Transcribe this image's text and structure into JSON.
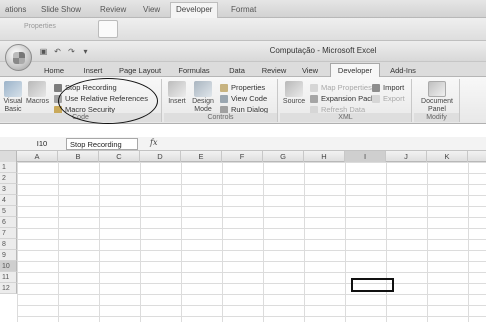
{
  "background_window": {
    "tabs": [
      "ations",
      "Slide Show",
      "Review",
      "View",
      "Developer",
      "Format"
    ],
    "active_tab": "Developer",
    "properties_label": "Properties"
  },
  "excel": {
    "title": "Computação - Microsoft Excel",
    "quick_access": [
      "save-icon",
      "undo-icon",
      "redo-icon",
      "dropdown-icon"
    ],
    "tabs": [
      "Home",
      "Insert",
      "Page Layout",
      "Formulas",
      "Data",
      "Review",
      "View",
      "Developer",
      "Add-Ins"
    ],
    "active_tab": "Developer",
    "ribbon": {
      "code": {
        "visual_basic": "Visual Basic",
        "macros": "Macros",
        "stop_recording": "Stop Recording",
        "relative_refs": "Use Relative References",
        "macro_security": "Macro Security",
        "label": "Code"
      },
      "controls": {
        "insert": "Insert",
        "design_mode": "Design Mode",
        "properties": "Properties",
        "view_code": "View Code",
        "run_dialog": "Run Dialog",
        "label": "Controls"
      },
      "xml": {
        "source": "Source",
        "map_properties": "Map Properties",
        "expansion_packs": "Expansion Packs",
        "refresh_data": "Refresh Data",
        "import": "Import",
        "export": "Export",
        "label": "XML"
      },
      "modify": {
        "document_panel": "Document Panel",
        "label": "Modify"
      }
    },
    "formula_bar": {
      "name_box": "I10",
      "content": "Stop Recording",
      "fx": "fx"
    },
    "columns": [
      "A",
      "B",
      "C",
      "D",
      "E",
      "F",
      "G",
      "H",
      "I",
      "J",
      "K"
    ],
    "rows": [
      "1",
      "2",
      "3",
      "4",
      "5",
      "6",
      "7",
      "8",
      "9",
      "10",
      "11",
      "12"
    ],
    "selected_cell": "I10",
    "colors": {
      "accent": "#111111",
      "ribbon_bg": "#e8e8e8"
    }
  }
}
